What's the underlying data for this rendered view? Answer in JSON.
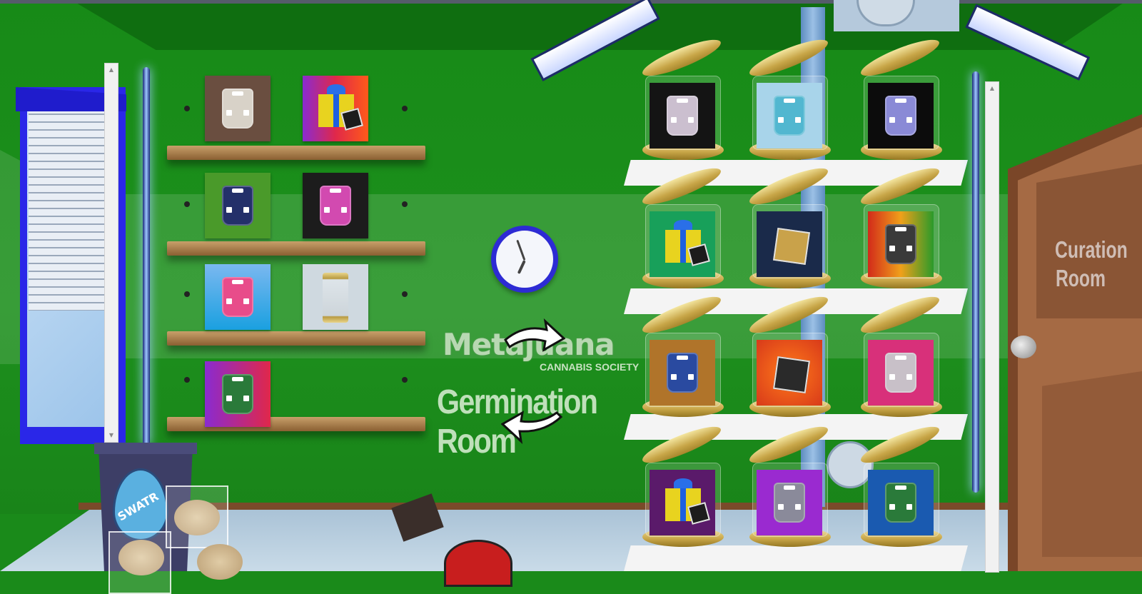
{
  "room": {
    "logo_title": "Metajuana",
    "logo_subtitle": "CANNABIS SOCIETY",
    "name": "Germination Room",
    "door_sign_line1": "Curation",
    "door_sign_line2": "Room",
    "bin_label": "SWATR"
  },
  "colors": {
    "wall": "#1a8a1a",
    "clock_rim": "#2d2bd4",
    "window_frame": "#2a27e8",
    "door": "#a56a44",
    "shelf_wood": "#b08050",
    "jar_gold": "#c8a648"
  },
  "wall_shelves": [
    {
      "items": [
        {
          "kind": "bag",
          "bg": "#6a4e40",
          "accent": "#d8d2c8",
          "name": "clear-bag"
        },
        {
          "kind": "gift",
          "bg": "linear-gradient(90deg,#8a2bd0,#e0284a,#ff5a1a)",
          "name": "gift-box"
        }
      ]
    },
    {
      "items": [
        {
          "kind": "bag",
          "bg": "#4a9a2a",
          "accent": "#24306a",
          "name": "navy-bag"
        },
        {
          "kind": "bag",
          "bg": "#1c1c1c",
          "accent": "#d24ab0",
          "name": "rainbow-bag"
        }
      ]
    },
    {
      "items": [
        {
          "kind": "bag",
          "bg": "linear-gradient(#7ab8f0,#1aa0e0)",
          "accent": "#e84c8a",
          "name": "rainbow-bag-water"
        },
        {
          "kind": "jar",
          "bg": "#cfd9e0",
          "accent": "#b89a40",
          "name": "mini-jar"
        }
      ]
    },
    {
      "items": [
        {
          "kind": "bag",
          "bg": "linear-gradient(90deg,#8a2bd0,#e0284a)",
          "accent": "#2a7a3a",
          "name": "green-bag"
        }
      ]
    }
  ],
  "jars": [
    [
      {
        "kind": "bag",
        "bg": "#141414",
        "accent": "#cbbfcf",
        "name": "clear-bag-jar"
      },
      {
        "kind": "bag",
        "bg": "#a8d4ea",
        "accent": "#52b7d0",
        "name": "teal-bag-jar"
      },
      {
        "kind": "bag",
        "bg": "#0c0c0c",
        "accent": "#8a8ad6",
        "name": "flame-bag-jar"
      }
    ],
    [
      {
        "kind": "gift",
        "bg": "#18a05a",
        "accent": "#e8d31f",
        "name": "gift-jar"
      },
      {
        "kind": "box",
        "bg": "#1a2a4a",
        "accent": "#c9a24a",
        "name": "gold-box-jar"
      },
      {
        "kind": "bag",
        "bg": "linear-gradient(90deg,#d22a1a,#f0a01a,#2a9a2a)",
        "accent": "#3a3a3a",
        "name": "black-bag-jar"
      }
    ],
    [
      {
        "kind": "bag",
        "bg": "#b0742a",
        "accent": "#2a4aa0",
        "name": "blue-bag-jar"
      },
      {
        "kind": "box",
        "bg": "radial-gradient(#ff7a1a,#d83a1a)",
        "accent": "#2a2a2a",
        "name": "black-box-jar"
      },
      {
        "kind": "bag",
        "bg": "#d8307a",
        "accent": "#c8c0c8",
        "name": "pink-bag-jar"
      }
    ],
    [
      {
        "kind": "gift",
        "bg": "#5a1a6a",
        "accent": "#e8d31f",
        "name": "gift-jar-2"
      },
      {
        "kind": "bag",
        "bg": "#9a2ad0",
        "accent": "#8a8a9a",
        "name": "silver-bag-jar"
      },
      {
        "kind": "bag",
        "bg": "#1a5ab0",
        "accent": "#2a7a3a",
        "name": "green-bag-jar"
      }
    ]
  ],
  "clock": {
    "hour_hand_deg": 115,
    "minute_hand_deg": 250
  }
}
